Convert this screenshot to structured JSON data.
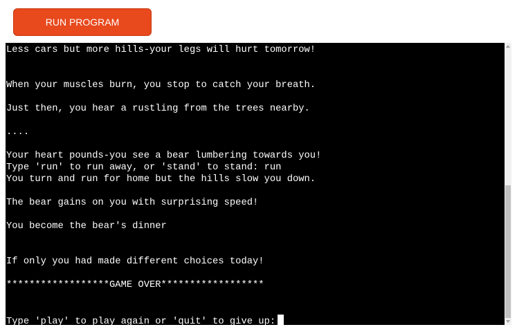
{
  "toolbar": {
    "run_label": "RUN PROGRAM"
  },
  "colors": {
    "run_button": "#e8491d",
    "terminal_bg": "#000000",
    "terminal_fg": "#ffffff"
  },
  "terminal": {
    "lines": [
      "Less cars but more hills-your legs will hurt tomorrow!",
      "",
      "",
      "When your muscles burn, you stop to catch your breath.",
      "",
      "Just then, you hear a rustling from the trees nearby.",
      "",
      "....",
      "",
      "Your heart pounds-you see a bear lumbering towards you!",
      "Type 'run' to run away, or 'stand' to stand: run",
      "You turn and run for home but the hills slow you down.",
      "",
      "The bear gains on you with surprising speed!",
      "",
      "You become the bear's dinner",
      "",
      "",
      "If only you had made different choices today!",
      "",
      "******************GAME OVER******************",
      "",
      ""
    ],
    "prompt": "Type 'play' to play again or 'quit' to give up:"
  }
}
